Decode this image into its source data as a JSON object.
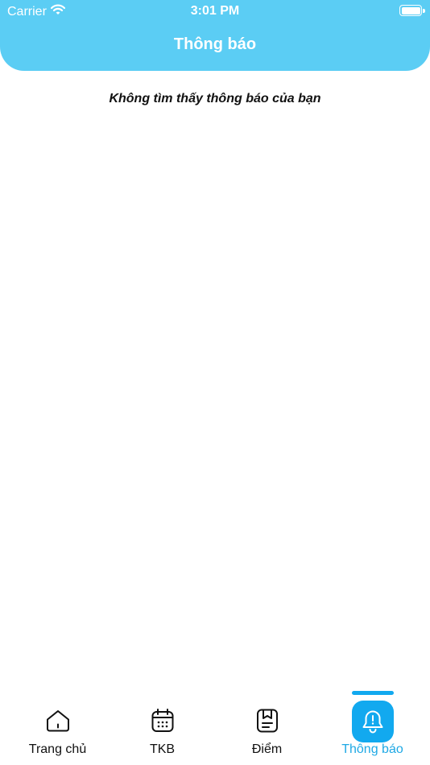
{
  "status_bar": {
    "carrier": "Carrier",
    "time": "3:01 PM",
    "battery_level": 1.0
  },
  "header": {
    "title": "Thông báo",
    "background_color": "#5bcdf4"
  },
  "main": {
    "empty_message": "Không tìm thấy thông báo của bạn"
  },
  "tabbar": {
    "active_color": "#12a9ef",
    "tabs": [
      {
        "label": "Trang chủ",
        "icon": "home-icon",
        "active": false
      },
      {
        "label": "TKB",
        "icon": "calendar-icon",
        "active": false
      },
      {
        "label": "Điểm",
        "icon": "grade-book-icon",
        "active": false
      },
      {
        "label": "Thông báo",
        "icon": "bell-icon",
        "active": true
      }
    ]
  }
}
